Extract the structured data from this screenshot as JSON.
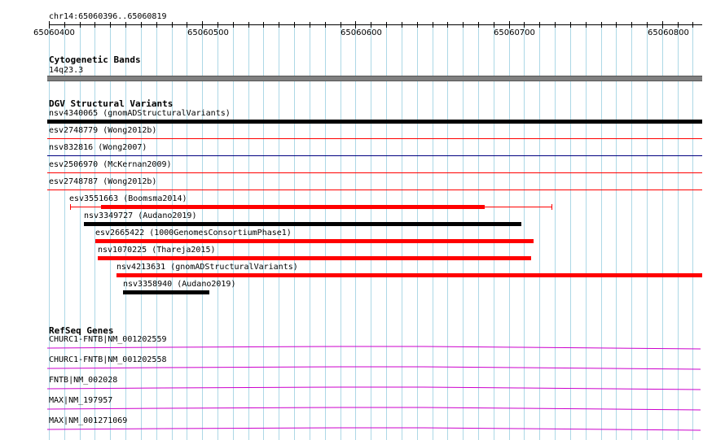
{
  "ruler": {
    "region": "chr14:65060396..65060819",
    "tick_labels": [
      "65060400",
      "65060500",
      "65060600",
      "65060700",
      "65060800"
    ]
  },
  "cytoband": {
    "title": "Cytogenetic Bands",
    "band": "14q23.3",
    "color": "#808080"
  },
  "dgv": {
    "title": "DGV Structural Variants",
    "features": [
      {
        "label": "nsv4340065 (gnomADStructuralVariants)",
        "color": "#000000"
      },
      {
        "label": "esv2748779 (Wong2012b)",
        "color": "#ff0000"
      },
      {
        "label": "nsv832816 (Wong2007)",
        "color": "#000080"
      },
      {
        "label": "esv2506970 (McKernan2009)",
        "color": "#ff0000"
      },
      {
        "label": "esv2748787 (Wong2012b)",
        "color": "#ff0000"
      },
      {
        "label": "esv3551663 (Boomsma2014)",
        "color": "#ff0000"
      },
      {
        "label": "nsv3349727 (Audano2019)",
        "color": "#000000"
      },
      {
        "label": "esv2665422 (1000GenomesConsortiumPhase1)",
        "color": "#ff0000"
      },
      {
        "label": "nsv1070225 (Thareja2015)",
        "color": "#ff0000"
      },
      {
        "label": "nsv4213631 (gnomADStructuralVariants)",
        "color": "#ff0000"
      },
      {
        "label": "nsv3358940 (Audano2019)",
        "color": "#000000"
      }
    ]
  },
  "refseq": {
    "title": "RefSeq Genes",
    "color": "#cc00cc",
    "genes": [
      {
        "label": "CHURC1-FNTB|NM_001202559"
      },
      {
        "label": "CHURC1-FNTB|NM_001202558"
      },
      {
        "label": "FNTB|NM_002028"
      },
      {
        "label": "MAX|NM_197957"
      },
      {
        "label": "MAX|NM_001271069"
      }
    ]
  },
  "colors": {
    "grid": "#add8e6",
    "red": "#ff0000",
    "black": "#000000",
    "navy": "#000080",
    "magenta": "#cc00cc"
  }
}
